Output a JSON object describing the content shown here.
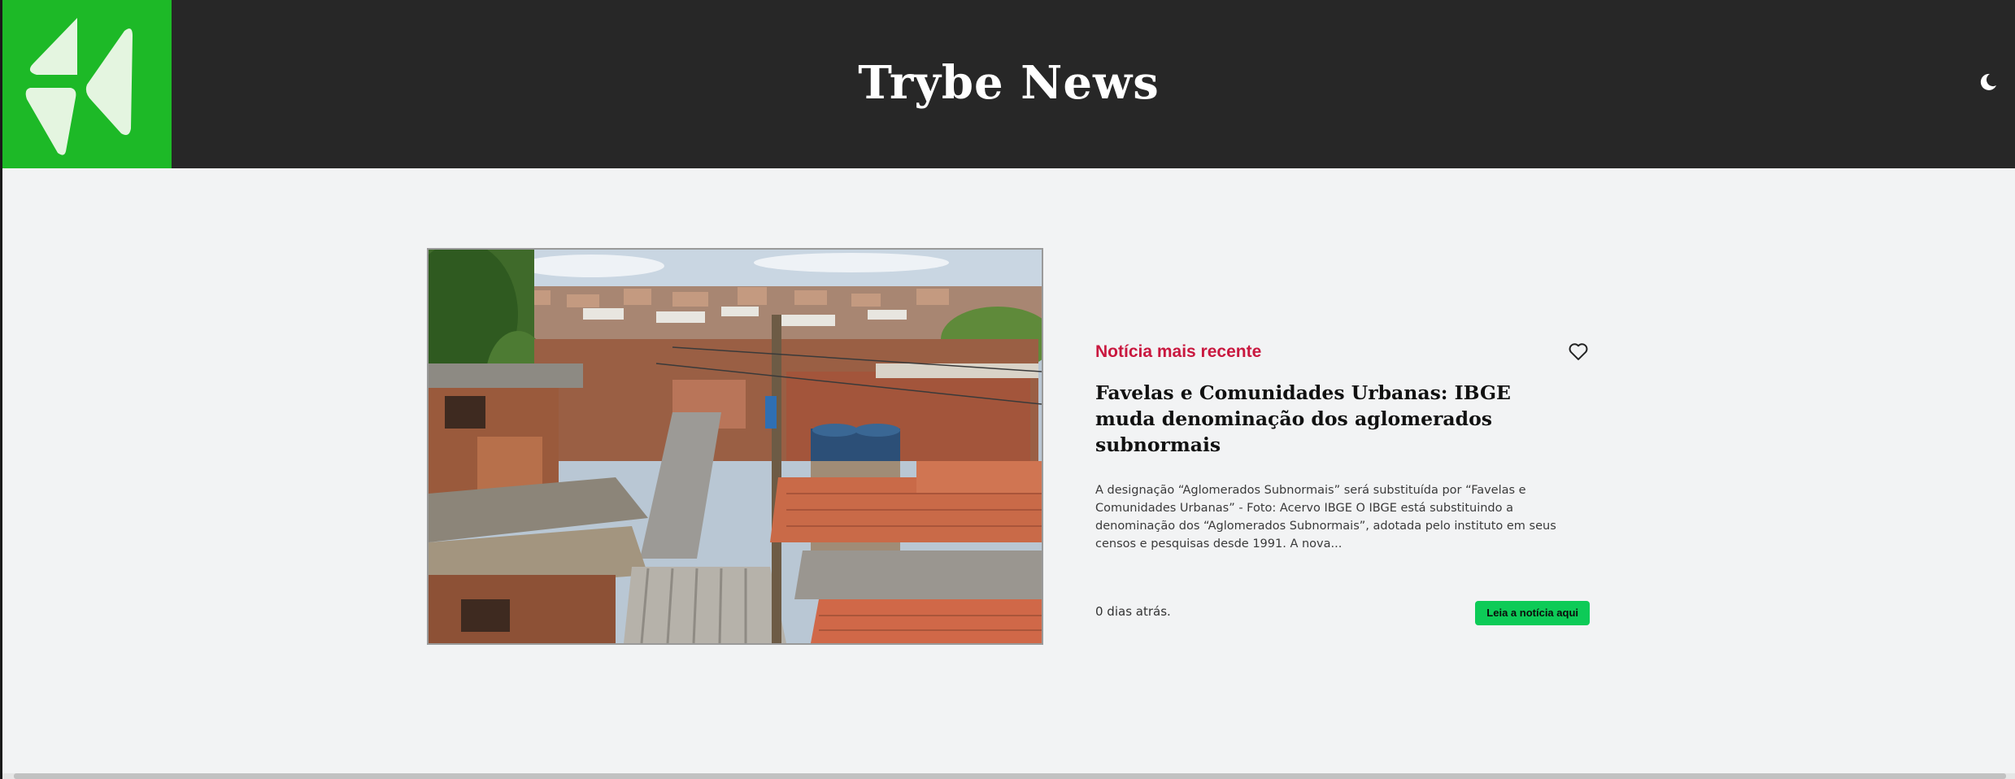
{
  "header": {
    "title": "Trybe News",
    "logo_icon": "paper-plane-logo-icon",
    "theme_icon": "moon-icon"
  },
  "news": {
    "tag": "Notícia mais recente",
    "headline": "Favelas e Comunidades Urbanas: IBGE muda denominação dos aglomerados subnormais",
    "summary": "A designação “Aglomerados Subnormais” será substituída por “Favelas e Comunidades Urbanas” - Foto: Acervo IBGE O IBGE está substituindo a denominação dos “Aglomerados Subnormais”, adotada pelo instituto em seus censos e pesquisas desde 1991. A nova...",
    "date": "0 dias atrás.",
    "read_button": "Leia a notícia aqui",
    "favorite_icon": "heart-outline-icon"
  },
  "colors": {
    "header_bg": "#272727",
    "logo_bg": "#1db927",
    "tag": "#c9183f",
    "button": "#0dcb57",
    "page_bg": "#f2f3f4"
  }
}
